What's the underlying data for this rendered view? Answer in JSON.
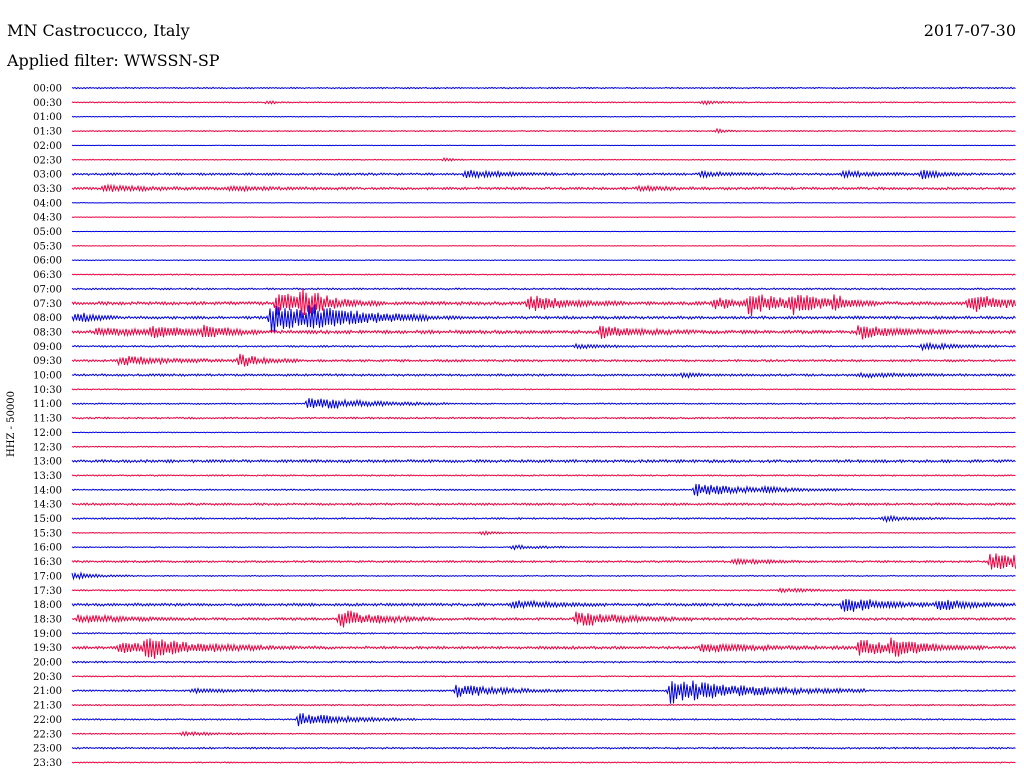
{
  "chart_data": {
    "type": "line",
    "title": "MN Castrocucco, Italy",
    "date": "2017-07-30",
    "subtitle": "Applied filter: WWSSN-SP",
    "ylabel": "HHZ - 50000",
    "colors": {
      "odd": "#0000e0",
      "even": "#ee0040",
      "text": "#000000"
    },
    "row_labels": [
      "00:00",
      "00:30",
      "01:00",
      "01:30",
      "02:00",
      "02:30",
      "03:00",
      "03:30",
      "04:00",
      "04:30",
      "05:00",
      "05:30",
      "06:00",
      "06:30",
      "07:00",
      "07:30",
      "08:00",
      "08:30",
      "09:00",
      "09:30",
      "10:00",
      "10:30",
      "11:00",
      "11:30",
      "12:00",
      "12:30",
      "13:00",
      "13:30",
      "14:00",
      "14:30",
      "15:00",
      "15:30",
      "16:00",
      "16:30",
      "17:00",
      "17:30",
      "18:00",
      "18:30",
      "19:00",
      "19:30",
      "20:00",
      "20:30",
      "21:00",
      "21:30",
      "22:00",
      "22:30",
      "23:00",
      "23:30"
    ],
    "x_range_minutes": [
      0,
      30
    ],
    "noise_level": [
      0.5,
      0.4,
      0.3,
      0.4,
      0.2,
      0.3,
      0.8,
      0.9,
      0.2,
      0.2,
      0.2,
      0.2,
      0.3,
      0.4,
      0.6,
      1.2,
      1.0,
      1.2,
      0.6,
      0.8,
      0.8,
      0.4,
      0.5,
      0.6,
      0.3,
      0.4,
      1.0,
      0.5,
      0.5,
      0.8,
      0.6,
      0.3,
      0.4,
      0.7,
      0.4,
      0.5,
      1.0,
      0.9,
      0.5,
      1.0,
      0.6,
      0.4,
      0.6,
      0.5,
      0.5,
      0.4,
      0.6,
      0.4
    ],
    "events": [
      {
        "row": 1,
        "t": 6.2,
        "amp": 2,
        "dur": 0.3
      },
      {
        "row": 1,
        "t": 20.0,
        "amp": 2,
        "dur": 0.6
      },
      {
        "row": 3,
        "t": 20.5,
        "amp": 2,
        "dur": 0.3
      },
      {
        "row": 5,
        "t": 11.8,
        "amp": 2,
        "dur": 0.3
      },
      {
        "row": 6,
        "t": 12.5,
        "amp": 4,
        "dur": 1.2
      },
      {
        "row": 6,
        "t": 20.0,
        "amp": 3,
        "dur": 0.8
      },
      {
        "row": 6,
        "t": 24.5,
        "amp": 3,
        "dur": 1.0
      },
      {
        "row": 6,
        "t": 27.0,
        "amp": 5,
        "dur": 0.6
      },
      {
        "row": 7,
        "t": 1.0,
        "amp": 3,
        "dur": 1.5
      },
      {
        "row": 7,
        "t": 5.0,
        "amp": 2,
        "dur": 1.5
      },
      {
        "row": 7,
        "t": 18.0,
        "amp": 2,
        "dur": 1.0
      },
      {
        "row": 15,
        "t": 6.5,
        "amp": 14,
        "dur": 0.8
      },
      {
        "row": 15,
        "t": 7.3,
        "amp": 12,
        "dur": 1.0
      },
      {
        "row": 15,
        "t": 14.5,
        "amp": 8,
        "dur": 1.2
      },
      {
        "row": 15,
        "t": 20.4,
        "amp": 6,
        "dur": 0.8
      },
      {
        "row": 15,
        "t": 21.5,
        "amp": 12,
        "dur": 1.2
      },
      {
        "row": 15,
        "t": 22.8,
        "amp": 8,
        "dur": 1.2
      },
      {
        "row": 15,
        "t": 24.2,
        "amp": 5,
        "dur": 0.5
      },
      {
        "row": 15,
        "t": 28.5,
        "amp": 9,
        "dur": 1.3
      },
      {
        "row": 16,
        "t": 0.1,
        "amp": 6,
        "dur": 0.6
      },
      {
        "row": 16,
        "t": 6.3,
        "amp": 16,
        "dur": 2.0
      },
      {
        "row": 16,
        "t": 7.5,
        "amp": 6,
        "dur": 2.0
      },
      {
        "row": 17,
        "t": 0.8,
        "amp": 4,
        "dur": 1.8
      },
      {
        "row": 17,
        "t": 2.5,
        "amp": 5,
        "dur": 1.2
      },
      {
        "row": 17,
        "t": 4.2,
        "amp": 6,
        "dur": 0.8
      },
      {
        "row": 17,
        "t": 16.8,
        "amp": 6,
        "dur": 1.2
      },
      {
        "row": 17,
        "t": 25.0,
        "amp": 7,
        "dur": 1.2
      },
      {
        "row": 18,
        "t": 27.0,
        "amp": 4,
        "dur": 1.0
      },
      {
        "row": 18,
        "t": 16.0,
        "amp": 2,
        "dur": 1.0
      },
      {
        "row": 19,
        "t": 1.5,
        "amp": 5,
        "dur": 1.5
      },
      {
        "row": 19,
        "t": 5.3,
        "amp": 7,
        "dur": 0.8
      },
      {
        "row": 20,
        "t": 19.4,
        "amp": 3,
        "dur": 0.4
      },
      {
        "row": 20,
        "t": 25.0,
        "amp": 2,
        "dur": 1.5
      },
      {
        "row": 22,
        "t": 7.5,
        "amp": 7,
        "dur": 1.8
      },
      {
        "row": 28,
        "t": 19.8,
        "amp": 6,
        "dur": 2.0
      },
      {
        "row": 28,
        "t": 22.0,
        "amp": 3,
        "dur": 0.3
      },
      {
        "row": 30,
        "t": 25.8,
        "amp": 3,
        "dur": 0.8
      },
      {
        "row": 31,
        "t": 13.0,
        "amp": 2,
        "dur": 0.6
      },
      {
        "row": 32,
        "t": 14.0,
        "amp": 2,
        "dur": 1.0
      },
      {
        "row": 33,
        "t": 21.0,
        "amp": 3,
        "dur": 1.0
      },
      {
        "row": 33,
        "t": 29.2,
        "amp": 12,
        "dur": 1.5
      },
      {
        "row": 34,
        "t": 0.0,
        "amp": 4,
        "dur": 0.8
      },
      {
        "row": 35,
        "t": 22.5,
        "amp": 2,
        "dur": 1.0
      },
      {
        "row": 36,
        "t": 14.0,
        "amp": 4,
        "dur": 1.2
      },
      {
        "row": 36,
        "t": 24.5,
        "amp": 8,
        "dur": 1.2
      },
      {
        "row": 36,
        "t": 27.5,
        "amp": 6,
        "dur": 1.0
      },
      {
        "row": 37,
        "t": 0.2,
        "amp": 4,
        "dur": 1.5
      },
      {
        "row": 37,
        "t": 8.5,
        "amp": 10,
        "dur": 1.2
      },
      {
        "row": 37,
        "t": 16.0,
        "amp": 8,
        "dur": 1.5
      },
      {
        "row": 39,
        "t": 1.5,
        "amp": 5,
        "dur": 2.5
      },
      {
        "row": 39,
        "t": 2.3,
        "amp": 9,
        "dur": 1.5
      },
      {
        "row": 39,
        "t": 20.0,
        "amp": 4,
        "dur": 2.0
      },
      {
        "row": 39,
        "t": 25.0,
        "amp": 9,
        "dur": 1.0
      },
      {
        "row": 39,
        "t": 26.0,
        "amp": 8,
        "dur": 1.2
      },
      {
        "row": 42,
        "t": 3.8,
        "amp": 2,
        "dur": 1.5
      },
      {
        "row": 42,
        "t": 12.2,
        "amp": 7,
        "dur": 1.5
      },
      {
        "row": 42,
        "t": 19.0,
        "amp": 13,
        "dur": 2.5
      },
      {
        "row": 44,
        "t": 7.2,
        "amp": 7,
        "dur": 1.5
      },
      {
        "row": 45,
        "t": 3.5,
        "amp": 2,
        "dur": 1.2
      }
    ]
  }
}
